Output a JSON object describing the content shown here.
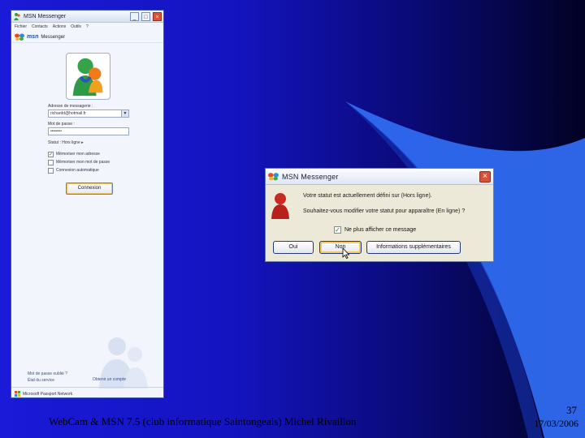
{
  "msn_window": {
    "title": "MSN Messenger",
    "menu": [
      "Fichier",
      "Contacts",
      "Actions",
      "Outils",
      "?"
    ],
    "logo_brand": "msn",
    "logo_word": "Messenger",
    "email_label": "Adresse de messagerie :",
    "email_value": "richardd@hotmail.fr",
    "password_label": "Mot de passe :",
    "password_value": "••••••••",
    "status_label": "Statut :",
    "status_value": "Hors ligne",
    "checkbox_1": "Mémoriser mon adresse",
    "checkbox_2": "Mémoriser mon mot de passe",
    "checkbox_3": "Connexion automatique",
    "connect_label": "Connexion",
    "link_1": "Mot de passe oublié ?",
    "link_2": "État du service",
    "link_3": "Obtenir un compte",
    "footer": "Microsoft Passport Network"
  },
  "dialog": {
    "title": "MSN Messenger",
    "message_1": "Votre statut est actuellement défini sur (Hors ligne).",
    "message_2": "Souhaitez-vous modifier votre statut pour apparaître (En ligne) ?",
    "checkbox_label": "Ne plus afficher ce message",
    "yes_label": "Oui",
    "no_label": "Non",
    "more_label": "Informations supplémentaires"
  },
  "slide": {
    "footer_text": "WebCam & MSN 7.5 (club informatique Saintongeais)  Michel Rivaillon",
    "page_number": "37",
    "date": "17/03/2006"
  }
}
